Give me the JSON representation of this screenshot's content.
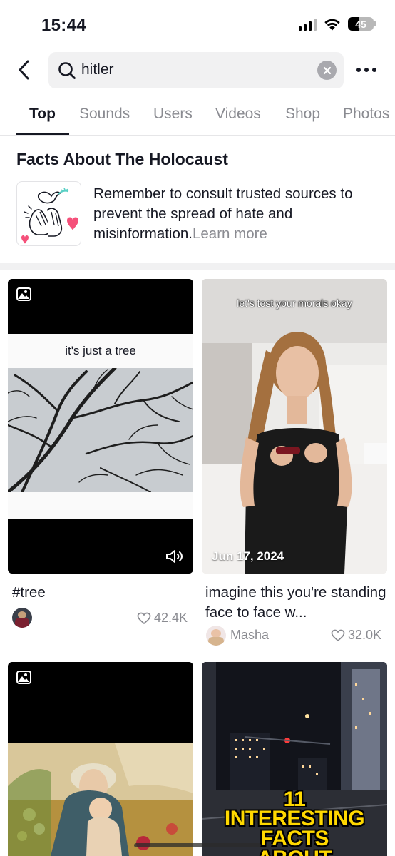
{
  "status_bar": {
    "time": "15:44",
    "battery": "45"
  },
  "search": {
    "query": "hitler"
  },
  "tabs": [
    {
      "label": "Top"
    },
    {
      "label": "Sounds"
    },
    {
      "label": "Users"
    },
    {
      "label": "Videos"
    },
    {
      "label": "Shop"
    },
    {
      "label": "Photos"
    }
  ],
  "active_tab": "Top",
  "info_card": {
    "title": "Facts About The Holocaust",
    "body": "Remember to consult trusted sources to prevent the spread of hate and misinformation.",
    "link": "Learn more"
  },
  "results": [
    {
      "caption": "#tree",
      "overlay_text": "it's just a tree",
      "author": "",
      "likes": "42.4K",
      "type": "photo",
      "icons": [
        "photo-icon",
        "speaker-icon"
      ]
    },
    {
      "caption": "imagine this you're standing face to face w...",
      "overlay_text": "let's test your morals okay",
      "date": "Jun 17, 2024",
      "author": "Masha",
      "likes": "32.0K",
      "type": "video"
    },
    {
      "type": "photo",
      "icons": [
        "photo-icon"
      ]
    },
    {
      "overlay_line1": "11",
      "overlay_line2": "INTERESTING",
      "overlay_line3": "FACTS",
      "overlay_line4": "ABOUT",
      "type": "video"
    }
  ],
  "colors": {
    "text_primary": "#161823",
    "text_secondary": "#8a8b91",
    "search_bg": "#f1f1f2",
    "heart_pink": "#f5507a",
    "facts_yellow": "#ffd800"
  }
}
